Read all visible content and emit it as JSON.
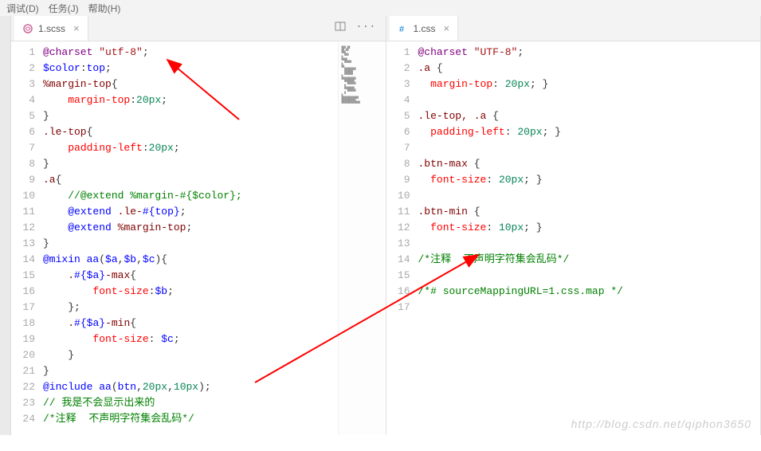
{
  "menubar": {
    "items": [
      "调试(D)",
      "任务(J)",
      "帮助(H)"
    ]
  },
  "left": {
    "tab": {
      "filename": "1.scss",
      "icon": "scss-file-icon"
    },
    "code": {
      "lines": [
        [
          [
            "tk-at",
            "@charset"
          ],
          [
            "tk-plain",
            " "
          ],
          [
            "tk-str",
            "\"utf-8\""
          ],
          [
            "tk-punc",
            ";"
          ]
        ],
        [
          [
            "tk-var",
            "$color"
          ],
          [
            "tk-punc",
            ":"
          ],
          [
            "tk-id",
            "top"
          ],
          [
            "tk-punc",
            ";"
          ]
        ],
        [
          [
            "tk-pct",
            "%margin-top"
          ],
          [
            "tk-punc",
            "{"
          ]
        ],
        [
          [
            "tk-plain",
            "    "
          ],
          [
            "tk-prop",
            "margin-top"
          ],
          [
            "tk-punc",
            ":"
          ],
          [
            "tk-num",
            "20px"
          ],
          [
            "tk-punc",
            ";"
          ]
        ],
        [
          [
            "tk-punc",
            "}"
          ]
        ],
        [
          [
            "tk-sel",
            ".le-top"
          ],
          [
            "tk-punc",
            "{"
          ]
        ],
        [
          [
            "tk-plain",
            "    "
          ],
          [
            "tk-prop",
            "padding-left"
          ],
          [
            "tk-punc",
            ":"
          ],
          [
            "tk-num",
            "20px"
          ],
          [
            "tk-punc",
            ";"
          ]
        ],
        [
          [
            "tk-punc",
            "}"
          ]
        ],
        [
          [
            "tk-sel",
            ".a"
          ],
          [
            "tk-punc",
            "{"
          ]
        ],
        [
          [
            "tk-plain",
            "    "
          ],
          [
            "tk-cmt",
            "//@extend %margin-#{$color};"
          ]
        ],
        [
          [
            "tk-plain",
            "    "
          ],
          [
            "tk-kw",
            "@extend"
          ],
          [
            "tk-plain",
            " "
          ],
          [
            "tk-sel",
            ".le-"
          ],
          [
            "tk-interp",
            "#{"
          ],
          [
            "tk-id",
            "top"
          ],
          [
            "tk-interp",
            "}"
          ],
          [
            "tk-punc",
            ";"
          ]
        ],
        [
          [
            "tk-plain",
            "    "
          ],
          [
            "tk-kw",
            "@extend"
          ],
          [
            "tk-plain",
            " "
          ],
          [
            "tk-pct",
            "%margin-top"
          ],
          [
            "tk-punc",
            ";"
          ]
        ],
        [
          [
            "tk-punc",
            "}"
          ]
        ],
        [
          [
            "tk-kw",
            "@mixin"
          ],
          [
            "tk-plain",
            " "
          ],
          [
            "tk-id",
            "aa"
          ],
          [
            "tk-punc",
            "("
          ],
          [
            "tk-var",
            "$a"
          ],
          [
            "tk-punc",
            ","
          ],
          [
            "tk-var",
            "$b"
          ],
          [
            "tk-punc",
            ","
          ],
          [
            "tk-var",
            "$c"
          ],
          [
            "tk-punc",
            "){"
          ]
        ],
        [
          [
            "tk-plain",
            "    "
          ],
          [
            "tk-sel",
            "."
          ],
          [
            "tk-interp",
            "#{"
          ],
          [
            "tk-var",
            "$a"
          ],
          [
            "tk-interp",
            "}"
          ],
          [
            "tk-sel",
            "-max"
          ],
          [
            "tk-punc",
            "{"
          ]
        ],
        [
          [
            "tk-plain",
            "        "
          ],
          [
            "tk-prop",
            "font-size"
          ],
          [
            "tk-punc",
            ":"
          ],
          [
            "tk-var",
            "$b"
          ],
          [
            "tk-punc",
            ";"
          ]
        ],
        [
          [
            "tk-plain",
            "    "
          ],
          [
            "tk-punc",
            "};"
          ]
        ],
        [
          [
            "tk-plain",
            "    "
          ],
          [
            "tk-sel",
            "."
          ],
          [
            "tk-interp",
            "#{"
          ],
          [
            "tk-var",
            "$a"
          ],
          [
            "tk-interp",
            "}"
          ],
          [
            "tk-sel",
            "-min"
          ],
          [
            "tk-punc",
            "{"
          ]
        ],
        [
          [
            "tk-plain",
            "        "
          ],
          [
            "tk-prop",
            "font-size"
          ],
          [
            "tk-punc",
            ": "
          ],
          [
            "tk-var",
            "$c"
          ],
          [
            "tk-punc",
            ";"
          ]
        ],
        [
          [
            "tk-plain",
            "    "
          ],
          [
            "tk-punc",
            "}"
          ]
        ],
        [
          [
            "tk-punc",
            "}"
          ]
        ],
        [
          [
            "tk-kw",
            "@include"
          ],
          [
            "tk-plain",
            " "
          ],
          [
            "tk-id",
            "aa"
          ],
          [
            "tk-punc",
            "("
          ],
          [
            "tk-id",
            "btn"
          ],
          [
            "tk-punc",
            ","
          ],
          [
            "tk-num",
            "20px"
          ],
          [
            "tk-punc",
            ","
          ],
          [
            "tk-num",
            "10px"
          ],
          [
            "tk-punc",
            ");"
          ]
        ],
        [
          [
            "tk-cmt",
            "// 我是不会显示出来的"
          ]
        ],
        [
          [
            "tk-cmt2",
            "/*注释  不声明字符集会乱码*/"
          ]
        ]
      ]
    }
  },
  "right": {
    "tab": {
      "filename": "1.css",
      "icon": "css-file-icon"
    },
    "code": {
      "lines": [
        [
          [
            "tk-at",
            "@charset"
          ],
          [
            "tk-plain",
            " "
          ],
          [
            "tk-str",
            "\"UTF-8\""
          ],
          [
            "tk-punc",
            ";"
          ]
        ],
        [
          [
            "tk-sel",
            ".a"
          ],
          [
            "tk-plain",
            " "
          ],
          [
            "tk-punc",
            "{"
          ]
        ],
        [
          [
            "tk-plain",
            "  "
          ],
          [
            "tk-prop",
            "margin-top"
          ],
          [
            "tk-punc",
            ": "
          ],
          [
            "tk-num",
            "20px"
          ],
          [
            "tk-punc",
            "; }"
          ]
        ],
        [],
        [
          [
            "tk-sel",
            ".le-top, .a"
          ],
          [
            "tk-plain",
            " "
          ],
          [
            "tk-punc",
            "{"
          ]
        ],
        [
          [
            "tk-plain",
            "  "
          ],
          [
            "tk-prop",
            "padding-left"
          ],
          [
            "tk-punc",
            ": "
          ],
          [
            "tk-num",
            "20px"
          ],
          [
            "tk-punc",
            "; }"
          ]
        ],
        [],
        [
          [
            "tk-sel",
            ".btn-max"
          ],
          [
            "tk-plain",
            " "
          ],
          [
            "tk-punc",
            "{"
          ]
        ],
        [
          [
            "tk-plain",
            "  "
          ],
          [
            "tk-prop",
            "font-size"
          ],
          [
            "tk-punc",
            ": "
          ],
          [
            "tk-num",
            "20px"
          ],
          [
            "tk-punc",
            "; }"
          ]
        ],
        [],
        [
          [
            "tk-sel",
            ".btn-min"
          ],
          [
            "tk-plain",
            " "
          ],
          [
            "tk-punc",
            "{"
          ]
        ],
        [
          [
            "tk-plain",
            "  "
          ],
          [
            "tk-prop",
            "font-size"
          ],
          [
            "tk-punc",
            ": "
          ],
          [
            "tk-num",
            "10px"
          ],
          [
            "tk-punc",
            "; }"
          ]
        ],
        [],
        [
          [
            "tk-cmt2",
            "/*注释  不声明字符集会乱码*/"
          ]
        ],
        [],
        [
          [
            "tk-cmt2",
            "/*# sourceMappingURL=1.css.map */"
          ]
        ],
        []
      ]
    }
  },
  "watermark": "http://blog.csdn.net/qiphon3650"
}
